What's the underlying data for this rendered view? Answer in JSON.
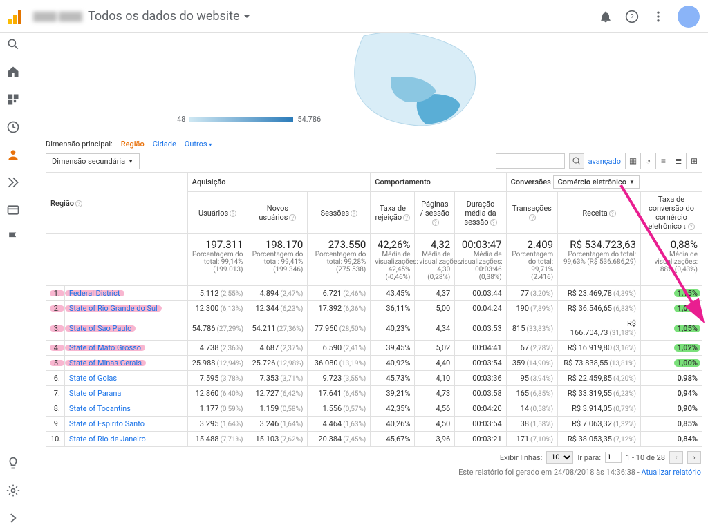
{
  "header": {
    "workspace_title": "Todos os dados do website",
    "blurred_text": "████ ████"
  },
  "sidebar_icons": [
    "search",
    "home",
    "dashboard",
    "clock",
    "person",
    "conversions",
    "tag",
    "flag",
    "lightbulb",
    "gear",
    "chevron"
  ],
  "map": {
    "scale_min": "48",
    "scale_max": "54.786"
  },
  "primary_dimension": {
    "label": "Dimensão principal:",
    "active": "Região",
    "links": [
      "Cidade",
      "Outros"
    ]
  },
  "secondary_dimension_btn": "Dimensão secundária",
  "advanced": "avançado",
  "table": {
    "groups": {
      "acq": "Aquisição",
      "beh": "Comportamento",
      "conv": "Conversões"
    },
    "conv_selector": "Comércio eletrônico",
    "headers": {
      "region": "Região",
      "users": "Usuários",
      "new_users": "Novos usuários",
      "sessions": "Sessões",
      "bounce": "Taxa de rejeição",
      "pps": "Páginas / sessão",
      "dur": "Duração média da sessão",
      "trans": "Transações",
      "rev": "Receita",
      "cr": "Taxa de conversão do comércio eletrônico"
    },
    "summary": {
      "users": {
        "v": "197.311",
        "sub": "Porcentagem do total: 99,14% (199.013)"
      },
      "new_users": {
        "v": "198.170",
        "sub": "Porcentagem do total: 99,41% (199.346)"
      },
      "sessions": {
        "v": "273.550",
        "sub": "Porcentagem do total: 99,28% (275.538)"
      },
      "bounce": {
        "v": "42,26%",
        "sub": "Média de visualizações: 42,45% (-0,46%)"
      },
      "pps": {
        "v": "4,32",
        "sub": "Média de visualizações: 4,30 (0,28%)"
      },
      "dur": {
        "v": "00:03:47",
        "sub": "Média de visualizações: 00:03:46 (0,38%)"
      },
      "trans": {
        "v": "2.409",
        "sub": "Porcentagem do total: 99,71% (2.416)"
      },
      "rev": {
        "v": "R$ 534.723,63",
        "sub": "Porcentagem do total: 99,63% (R$ 536.686,29)"
      },
      "cr": {
        "v": "0,88%",
        "sub": "Média de visualizações: 88% (0,43%)"
      }
    },
    "rows": [
      {
        "n": "1.",
        "name": "Federal District",
        "u": "5.112",
        "up": "(2,55%)",
        "nu": "4.894",
        "nup": "(2,47%)",
        "s": "6.721",
        "sp": "(2,46%)",
        "b": "43,45%",
        "pp": "4,37",
        "d": "00:03:44",
        "t": "77",
        "tp": "(3,20%)",
        "r": "R$ 23.469,78",
        "rp": "(4,39%)",
        "c": "1,15%",
        "hl": true
      },
      {
        "n": "2.",
        "name": "State of Rio Grande do Sul",
        "u": "12.300",
        "up": "(6,13%)",
        "nu": "12.344",
        "nup": "(6,23%)",
        "s": "17.392",
        "sp": "(6,36%)",
        "b": "36,11%",
        "pp": "5,00",
        "d": "00:04:24",
        "t": "190",
        "tp": "(7,89%)",
        "r": "R$ 36.546,65",
        "rp": "(6,83%)",
        "c": "1,09%",
        "hl": true
      },
      {
        "n": "3.",
        "name": "State of Sao Paulo",
        "u": "54.786",
        "up": "(27,29%)",
        "nu": "54.211",
        "nup": "(27,36%)",
        "s": "77.960",
        "sp": "(28,50%)",
        "b": "40,23%",
        "pp": "4,34",
        "d": "00:03:53",
        "t": "815",
        "tp": "(33,83%)",
        "r": "R$ 166.704,73",
        "rp": "(31,18%)",
        "c": "1,05%",
        "hl": true
      },
      {
        "n": "4.",
        "name": "State of Mato Grosso",
        "u": "4.738",
        "up": "(2,36%)",
        "nu": "4.687",
        "nup": "(2,37%)",
        "s": "6.590",
        "sp": "(2,41%)",
        "b": "39,45%",
        "pp": "5,02",
        "d": "00:04:41",
        "t": "67",
        "tp": "(2,78%)",
        "r": "R$ 16.919,80",
        "rp": "(3,16%)",
        "c": "1,02%",
        "hl": true
      },
      {
        "n": "5.",
        "name": "State of Minas Gerais",
        "u": "25.988",
        "up": "(12,94%)",
        "nu": "25.726",
        "nup": "(12,98%)",
        "s": "36.080",
        "sp": "(13,19%)",
        "b": "40,92%",
        "pp": "4,40",
        "d": "00:03:54",
        "t": "359",
        "tp": "(14,90%)",
        "r": "R$ 73.838,55",
        "rp": "(13,81%)",
        "c": "1,00%",
        "hl": true
      },
      {
        "n": "6.",
        "name": "State of Goias",
        "u": "7.595",
        "up": "(3,78%)",
        "nu": "7.353",
        "nup": "(3,71%)",
        "s": "9.723",
        "sp": "(3,55%)",
        "b": "45,73%",
        "pp": "4,10",
        "d": "00:03:36",
        "t": "95",
        "tp": "(3,94%)",
        "r": "R$ 22.459,85",
        "rp": "(4,20%)",
        "c": "0,98%",
        "hl": false
      },
      {
        "n": "7.",
        "name": "State of Parana",
        "u": "12.860",
        "up": "(6,40%)",
        "nu": "12.727",
        "nup": "(6,42%)",
        "s": "17.641",
        "sp": "(6,45%)",
        "b": "39,21%",
        "pp": "4,73",
        "d": "00:03:58",
        "t": "165",
        "tp": "(6,85%)",
        "r": "R$ 33.319,55",
        "rp": "(6,23%)",
        "c": "0,94%",
        "hl": false
      },
      {
        "n": "8.",
        "name": "State of Tocantins",
        "u": "1.177",
        "up": "(0,59%)",
        "nu": "1.159",
        "nup": "(0,58%)",
        "s": "1.556",
        "sp": "(0,57%)",
        "b": "42,35%",
        "pp": "4,56",
        "d": "00:04:20",
        "t": "14",
        "tp": "(0,58%)",
        "r": "R$ 3.914,05",
        "rp": "(0,73%)",
        "c": "0,90%",
        "hl": false
      },
      {
        "n": "9.",
        "name": "State of Espirito Santo",
        "u": "3.295",
        "up": "(1,64%)",
        "nu": "3.246",
        "nup": "(1,64%)",
        "s": "4.464",
        "sp": "(1,63%)",
        "b": "40,26%",
        "pp": "4,50",
        "d": "00:03:54",
        "t": "38",
        "tp": "(1,58%)",
        "r": "R$ 7.063,32",
        "rp": "(1,32%)",
        "c": "0,85%",
        "hl": false
      },
      {
        "n": "10.",
        "name": "State of Rio de Janeiro",
        "u": "15.488",
        "up": "(7,71%)",
        "nu": "15.103",
        "nup": "(7,62%)",
        "s": "20.384",
        "sp": "(7,45%)",
        "b": "45,67%",
        "pp": "3,96",
        "d": "00:03:21",
        "t": "171",
        "tp": "(7,10%)",
        "r": "R$ 38.053,35",
        "rp": "(7,12%)",
        "c": "0,84%",
        "hl": false
      }
    ]
  },
  "pager": {
    "show_rows": "Exibir linhas:",
    "rows_value": "10",
    "goto": "Ir para:",
    "goto_value": "1",
    "range": "1 - 10 de 28"
  },
  "timestamp": {
    "prefix": "Este relatório foi gerado em 24/08/2018 às 14:36:38 - ",
    "link": "Atualizar relatório"
  }
}
